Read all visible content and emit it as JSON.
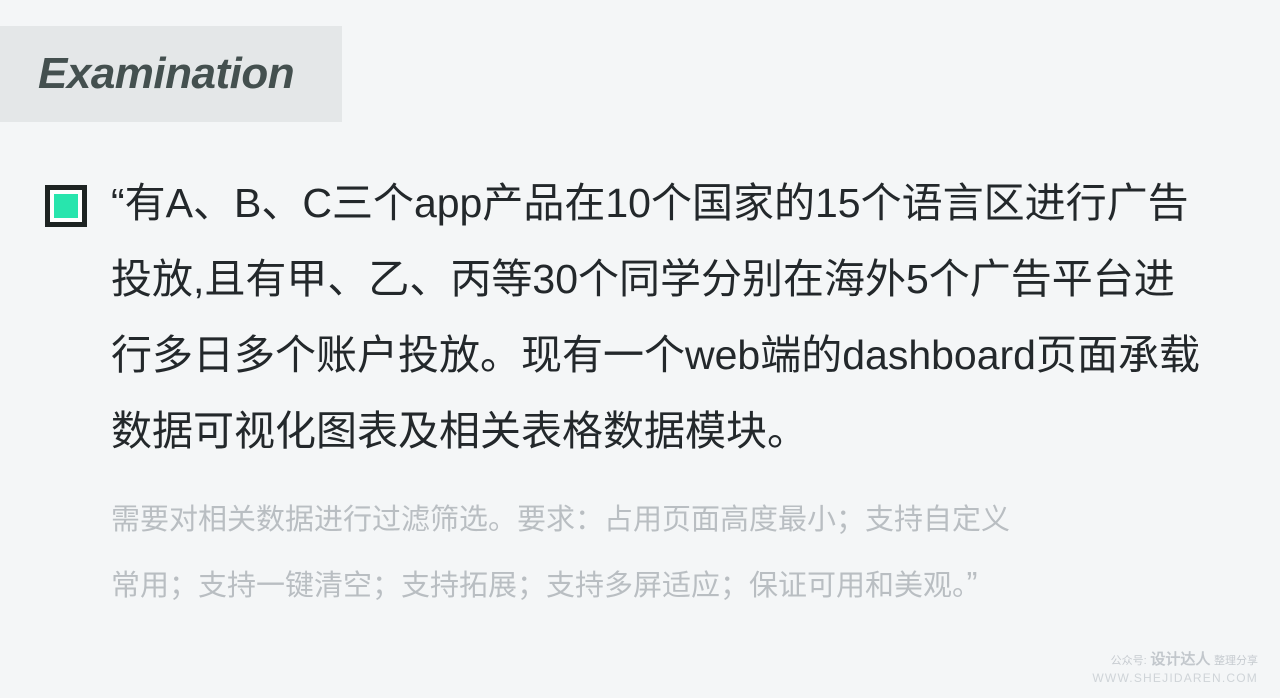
{
  "page": {
    "background_color": "#f4f6f7"
  },
  "header": {
    "title": "Examination",
    "band_color": "#e4e7e8",
    "title_color": "#44504f"
  },
  "bullet": {
    "icon": "filled-square-marker",
    "frame_color": "#1d2322",
    "accent_color": "#28e5ad"
  },
  "quote": {
    "main_color": "#23282b",
    "main_lines": [
      "“有A、B、C三个app产品在10个国家的15个语言区进行广告",
      "投放,且有甲、乙、丙等30个同学分别在海外5个广告平台进",
      "行多日多个账户投放。现有一个web端的dashboard页面承载",
      "数据可视化图表及相关表格数据模块。"
    ],
    "sub_color": "#b9bec2",
    "sub_lines": [
      "需要对相关数据进行过滤筛选。要求：占用页面高度最小；支持自定义",
      "常用；支持一键清空；支持拓展；支持多屏适应；保证可用和美观。"
    ],
    "closing_quote": "”"
  },
  "watermark": {
    "prefix": "公众号:",
    "brand": "设计达人",
    "suffix": "整理分享",
    "url": "WWW.SHEJIDAREN.COM",
    "color": "#ccd1d5"
  }
}
